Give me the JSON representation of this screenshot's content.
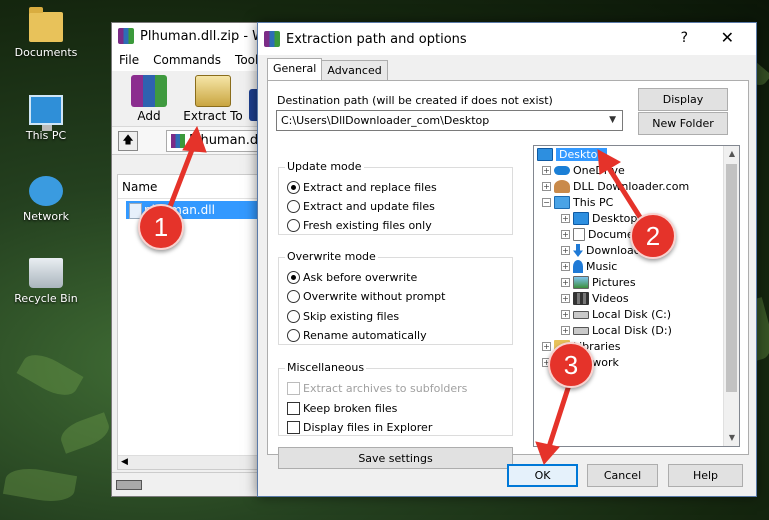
{
  "desktop": {
    "icons": [
      {
        "label": "Documents",
        "icon": "folder-icon"
      },
      {
        "label": "This PC",
        "icon": "computer-icon"
      },
      {
        "label": "Network",
        "icon": "network-icon"
      },
      {
        "label": "Recycle Bin",
        "icon": "recycle-bin-icon"
      }
    ]
  },
  "winrar": {
    "title": "Plhuman.dll.zip - Wi",
    "menu": [
      "File",
      "Commands",
      "Tools"
    ],
    "toolbar": {
      "add_label": "Add",
      "extract_label": "Extract To"
    },
    "path_text": "Plhuman.dll.zip",
    "list_header_name": "Name",
    "file_row": "plhuman.dll"
  },
  "dialog": {
    "title": "Extraction path and options",
    "help": "?",
    "close": "✕",
    "tabs": [
      "General",
      "Advanced"
    ],
    "destination_label": "Destination path (will be created if does not exist)",
    "destination_value": "C:\\Users\\DllDownloader_com\\Desktop",
    "display_button": "Display",
    "new_folder_button": "New Folder",
    "update_mode": {
      "title": "Update mode",
      "options": [
        "Extract and replace files",
        "Extract and update files",
        "Fresh existing files only"
      ],
      "selected": 0
    },
    "overwrite_mode": {
      "title": "Overwrite mode",
      "options": [
        "Ask before overwrite",
        "Overwrite without prompt",
        "Skip existing files",
        "Rename automatically"
      ],
      "selected": 0
    },
    "misc": {
      "title": "Miscellaneous",
      "options": [
        "Extract archives to subfolders",
        "Keep broken files",
        "Display files in Explorer"
      ]
    },
    "save_settings_button": "Save settings",
    "tree": [
      {
        "label": "Desktop",
        "icon": "monitor"
      },
      {
        "label": "OneDrive",
        "icon": "cloud"
      },
      {
        "label": "DLL Downloader.com",
        "icon": "person"
      },
      {
        "label": "This PC",
        "icon": "pc"
      },
      {
        "label": "Desktop",
        "icon": "monitor"
      },
      {
        "label": "Documents",
        "icon": "doc"
      },
      {
        "label": "Downloads",
        "icon": "down"
      },
      {
        "label": "Music",
        "icon": "music"
      },
      {
        "label": "Pictures",
        "icon": "pic"
      },
      {
        "label": "Videos",
        "icon": "vid"
      },
      {
        "label": "Local Disk (C:)",
        "icon": "disk"
      },
      {
        "label": "Local Disk (D:)",
        "icon": "disk"
      },
      {
        "label": "Libraries",
        "icon": "folder"
      },
      {
        "label": "Network",
        "icon": "pc"
      }
    ],
    "ok_button": "OK",
    "cancel_button": "Cancel",
    "help_button": "Help"
  },
  "annotations": [
    "1",
    "2",
    "3"
  ],
  "colors": {
    "selection": "#3399ff",
    "marker": "#e5332a",
    "accent_border": "#0078d7"
  }
}
